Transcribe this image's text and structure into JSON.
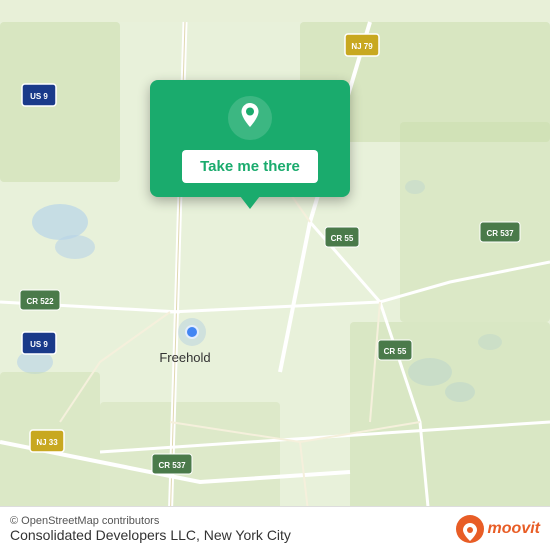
{
  "map": {
    "background_color": "#e8f0d8",
    "center_label": "Freehold",
    "route_labels": [
      "US 9",
      "US 9",
      "NJ 79",
      "NJ 33",
      "CR 522",
      "CR 537",
      "CR 537",
      "CR 55",
      "CR 55"
    ],
    "popup": {
      "button_label": "Take me there",
      "accent_color": "#1aab6d"
    }
  },
  "bottom_bar": {
    "osm_credit": "© OpenStreetMap contributors",
    "location_text": "Consolidated Developers LLC, New York City",
    "logo_text": "moovit"
  }
}
